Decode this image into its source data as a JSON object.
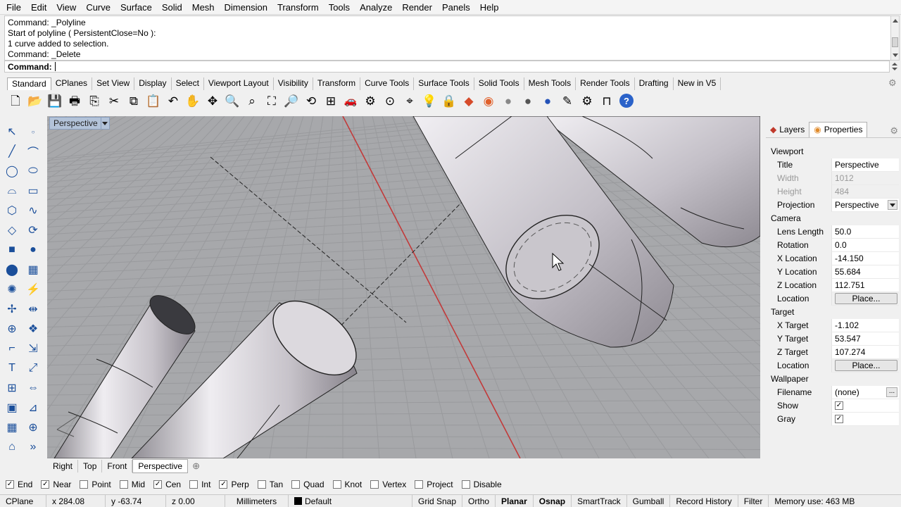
{
  "menu": [
    "File",
    "Edit",
    "View",
    "Curve",
    "Surface",
    "Solid",
    "Mesh",
    "Dimension",
    "Transform",
    "Tools",
    "Analyze",
    "Render",
    "Panels",
    "Help"
  ],
  "command_history": [
    "Command: _Polyline",
    "Start of polyline ( PersistentClose=No ):",
    "1 curve added to selection.",
    "Command: _Delete"
  ],
  "command_prompt": "Command:",
  "toolbar_tabs": [
    "Standard",
    "CPlanes",
    "Set View",
    "Display",
    "Select",
    "Viewport Layout",
    "Visibility",
    "Transform",
    "Curve Tools",
    "Surface Tools",
    "Solid Tools",
    "Mesh Tools",
    "Render Tools",
    "Drafting",
    "New in V5"
  ],
  "toolbar_icons": [
    {
      "name": "new-file-icon",
      "glyph": "🗋"
    },
    {
      "name": "open-folder-icon",
      "glyph": "📂"
    },
    {
      "name": "save-icon",
      "glyph": "💾"
    },
    {
      "name": "print-icon",
      "glyph": "🖶"
    },
    {
      "name": "import-icon",
      "glyph": "⎘"
    },
    {
      "name": "cut-icon",
      "glyph": "✂"
    },
    {
      "name": "copy-icon",
      "glyph": "⧉"
    },
    {
      "name": "paste-icon",
      "glyph": "📋"
    },
    {
      "name": "undo-icon",
      "glyph": "↶"
    },
    {
      "name": "pan-icon",
      "glyph": "✋"
    },
    {
      "name": "rotate-view-icon",
      "glyph": "✥"
    },
    {
      "name": "zoom-icon",
      "glyph": "🔍"
    },
    {
      "name": "zoom-window-icon",
      "glyph": "⌕"
    },
    {
      "name": "zoom-extents-icon",
      "glyph": "⛶"
    },
    {
      "name": "zoom-selected-icon",
      "glyph": "🔎"
    },
    {
      "name": "undo-view-icon",
      "glyph": "⟲"
    },
    {
      "name": "four-viewports-icon",
      "glyph": "⊞"
    },
    {
      "name": "car-icon",
      "glyph": "🚗"
    },
    {
      "name": "shade-icon",
      "glyph": "⚙"
    },
    {
      "name": "cplane-icon",
      "glyph": "⊙"
    },
    {
      "name": "snap-icon",
      "glyph": "⌖"
    },
    {
      "name": "light-icon",
      "glyph": "💡"
    },
    {
      "name": "lock-icon",
      "glyph": "🔒"
    },
    {
      "name": "layer-icon",
      "glyph": "◆"
    },
    {
      "name": "color-wheel-icon",
      "glyph": "◉"
    },
    {
      "name": "sphere-grey-icon",
      "glyph": "●"
    },
    {
      "name": "sphere-shaded-icon",
      "glyph": "●"
    },
    {
      "name": "sphere-blue-icon",
      "glyph": "●"
    },
    {
      "name": "render-pen-icon",
      "glyph": "✎"
    },
    {
      "name": "options-gear-icon",
      "glyph": "⚙"
    },
    {
      "name": "dimension-icon",
      "glyph": "⊓"
    },
    {
      "name": "help-icon",
      "glyph": "?"
    }
  ],
  "left_tools": [
    [
      "select-arrow-icon",
      "point-icon"
    ],
    [
      "polyline-icon",
      "curve-icon"
    ],
    [
      "circle-icon",
      "ellipse-icon"
    ],
    [
      "arc-icon",
      "rectangle-icon"
    ],
    [
      "polygon-icon",
      "freeform-icon"
    ],
    [
      "surface-icon",
      "revolve-icon"
    ],
    [
      "box-icon",
      "sphere-icon"
    ],
    [
      "cylinder-icon",
      "mesh-icon"
    ],
    [
      "explode-icon",
      "split-icon"
    ],
    [
      "move-icon",
      "align-icon"
    ],
    [
      "boolean-icon",
      "group-icon"
    ],
    [
      "fillet-icon",
      "offset-icon"
    ],
    [
      "text-icon",
      "scale-icon"
    ],
    [
      "array-icon",
      "mirror-icon"
    ],
    [
      "block-icon",
      "dimension-tool-icon"
    ],
    [
      "grid-icon",
      "analyze-icon"
    ],
    [
      "render-tool-icon",
      "more-icon"
    ]
  ],
  "viewport": {
    "title": "Perspective"
  },
  "viewport_tabs": [
    "Right",
    "Top",
    "Front",
    "Perspective"
  ],
  "panel": {
    "tabs": [
      "Layers",
      "Properties"
    ],
    "sections": [
      {
        "title": "Viewport",
        "rows": [
          {
            "k": "Title",
            "v": "Perspective"
          },
          {
            "k": "Width",
            "v": "1012",
            "disabled": true
          },
          {
            "k": "Height",
            "v": "484",
            "disabled": true
          },
          {
            "k": "Projection",
            "v": "Perspective",
            "dropdown": true
          }
        ]
      },
      {
        "title": "Camera",
        "rows": [
          {
            "k": "Lens Length",
            "v": "50.0"
          },
          {
            "k": "Rotation",
            "v": "0.0"
          },
          {
            "k": "X Location",
            "v": "-14.150"
          },
          {
            "k": "Y Location",
            "v": "55.684"
          },
          {
            "k": "Z Location",
            "v": "112.751"
          },
          {
            "k": "Location",
            "button": "Place..."
          }
        ]
      },
      {
        "title": "Target",
        "rows": [
          {
            "k": "X Target",
            "v": "-1.102"
          },
          {
            "k": "Y Target",
            "v": "53.547"
          },
          {
            "k": "Z Target",
            "v": "107.274"
          },
          {
            "k": "Location",
            "button": "Place..."
          }
        ]
      },
      {
        "title": "Wallpaper",
        "rows": [
          {
            "k": "Filename",
            "v": "(none)",
            "dots": "..."
          },
          {
            "k": "Show",
            "check": true
          },
          {
            "k": "Gray",
            "check": true
          }
        ]
      }
    ]
  },
  "osnaps": [
    {
      "label": "End",
      "checked": true
    },
    {
      "label": "Near",
      "checked": true
    },
    {
      "label": "Point",
      "checked": false
    },
    {
      "label": "Mid",
      "checked": false
    },
    {
      "label": "Cen",
      "checked": true
    },
    {
      "label": "Int",
      "checked": false
    },
    {
      "label": "Perp",
      "checked": true
    },
    {
      "label": "Tan",
      "checked": false
    },
    {
      "label": "Quad",
      "checked": false
    },
    {
      "label": "Knot",
      "checked": false
    },
    {
      "label": "Vertex",
      "checked": false
    },
    {
      "label": "Project",
      "checked": false
    },
    {
      "label": "Disable",
      "checked": false
    }
  ],
  "status": {
    "cplane": "CPlane",
    "x": "x 284.08",
    "y": "y -63.74",
    "z": "z 0.00",
    "units": "Millimeters",
    "layer": "Default",
    "toggles": [
      {
        "label": "Grid Snap",
        "bold": false
      },
      {
        "label": "Ortho",
        "bold": false
      },
      {
        "label": "Planar",
        "bold": true
      },
      {
        "label": "Osnap",
        "bold": true
      },
      {
        "label": "SmartTrack",
        "bold": false
      },
      {
        "label": "Gumball",
        "bold": false
      },
      {
        "label": "Record History",
        "bold": false
      },
      {
        "label": "Filter",
        "bold": false
      }
    ],
    "memory": "Memory use: 463 MB"
  },
  "colors": {
    "viewport_bg": "#a7a8ab",
    "grid_line": "#9a9b9e",
    "x_axis": "#c23a3a",
    "title_bg": "#b3c3d9",
    "tube_light": "#e8e6ea",
    "tube_mid": "#b9b5bd",
    "tube_dark": "#3a3a3f"
  }
}
